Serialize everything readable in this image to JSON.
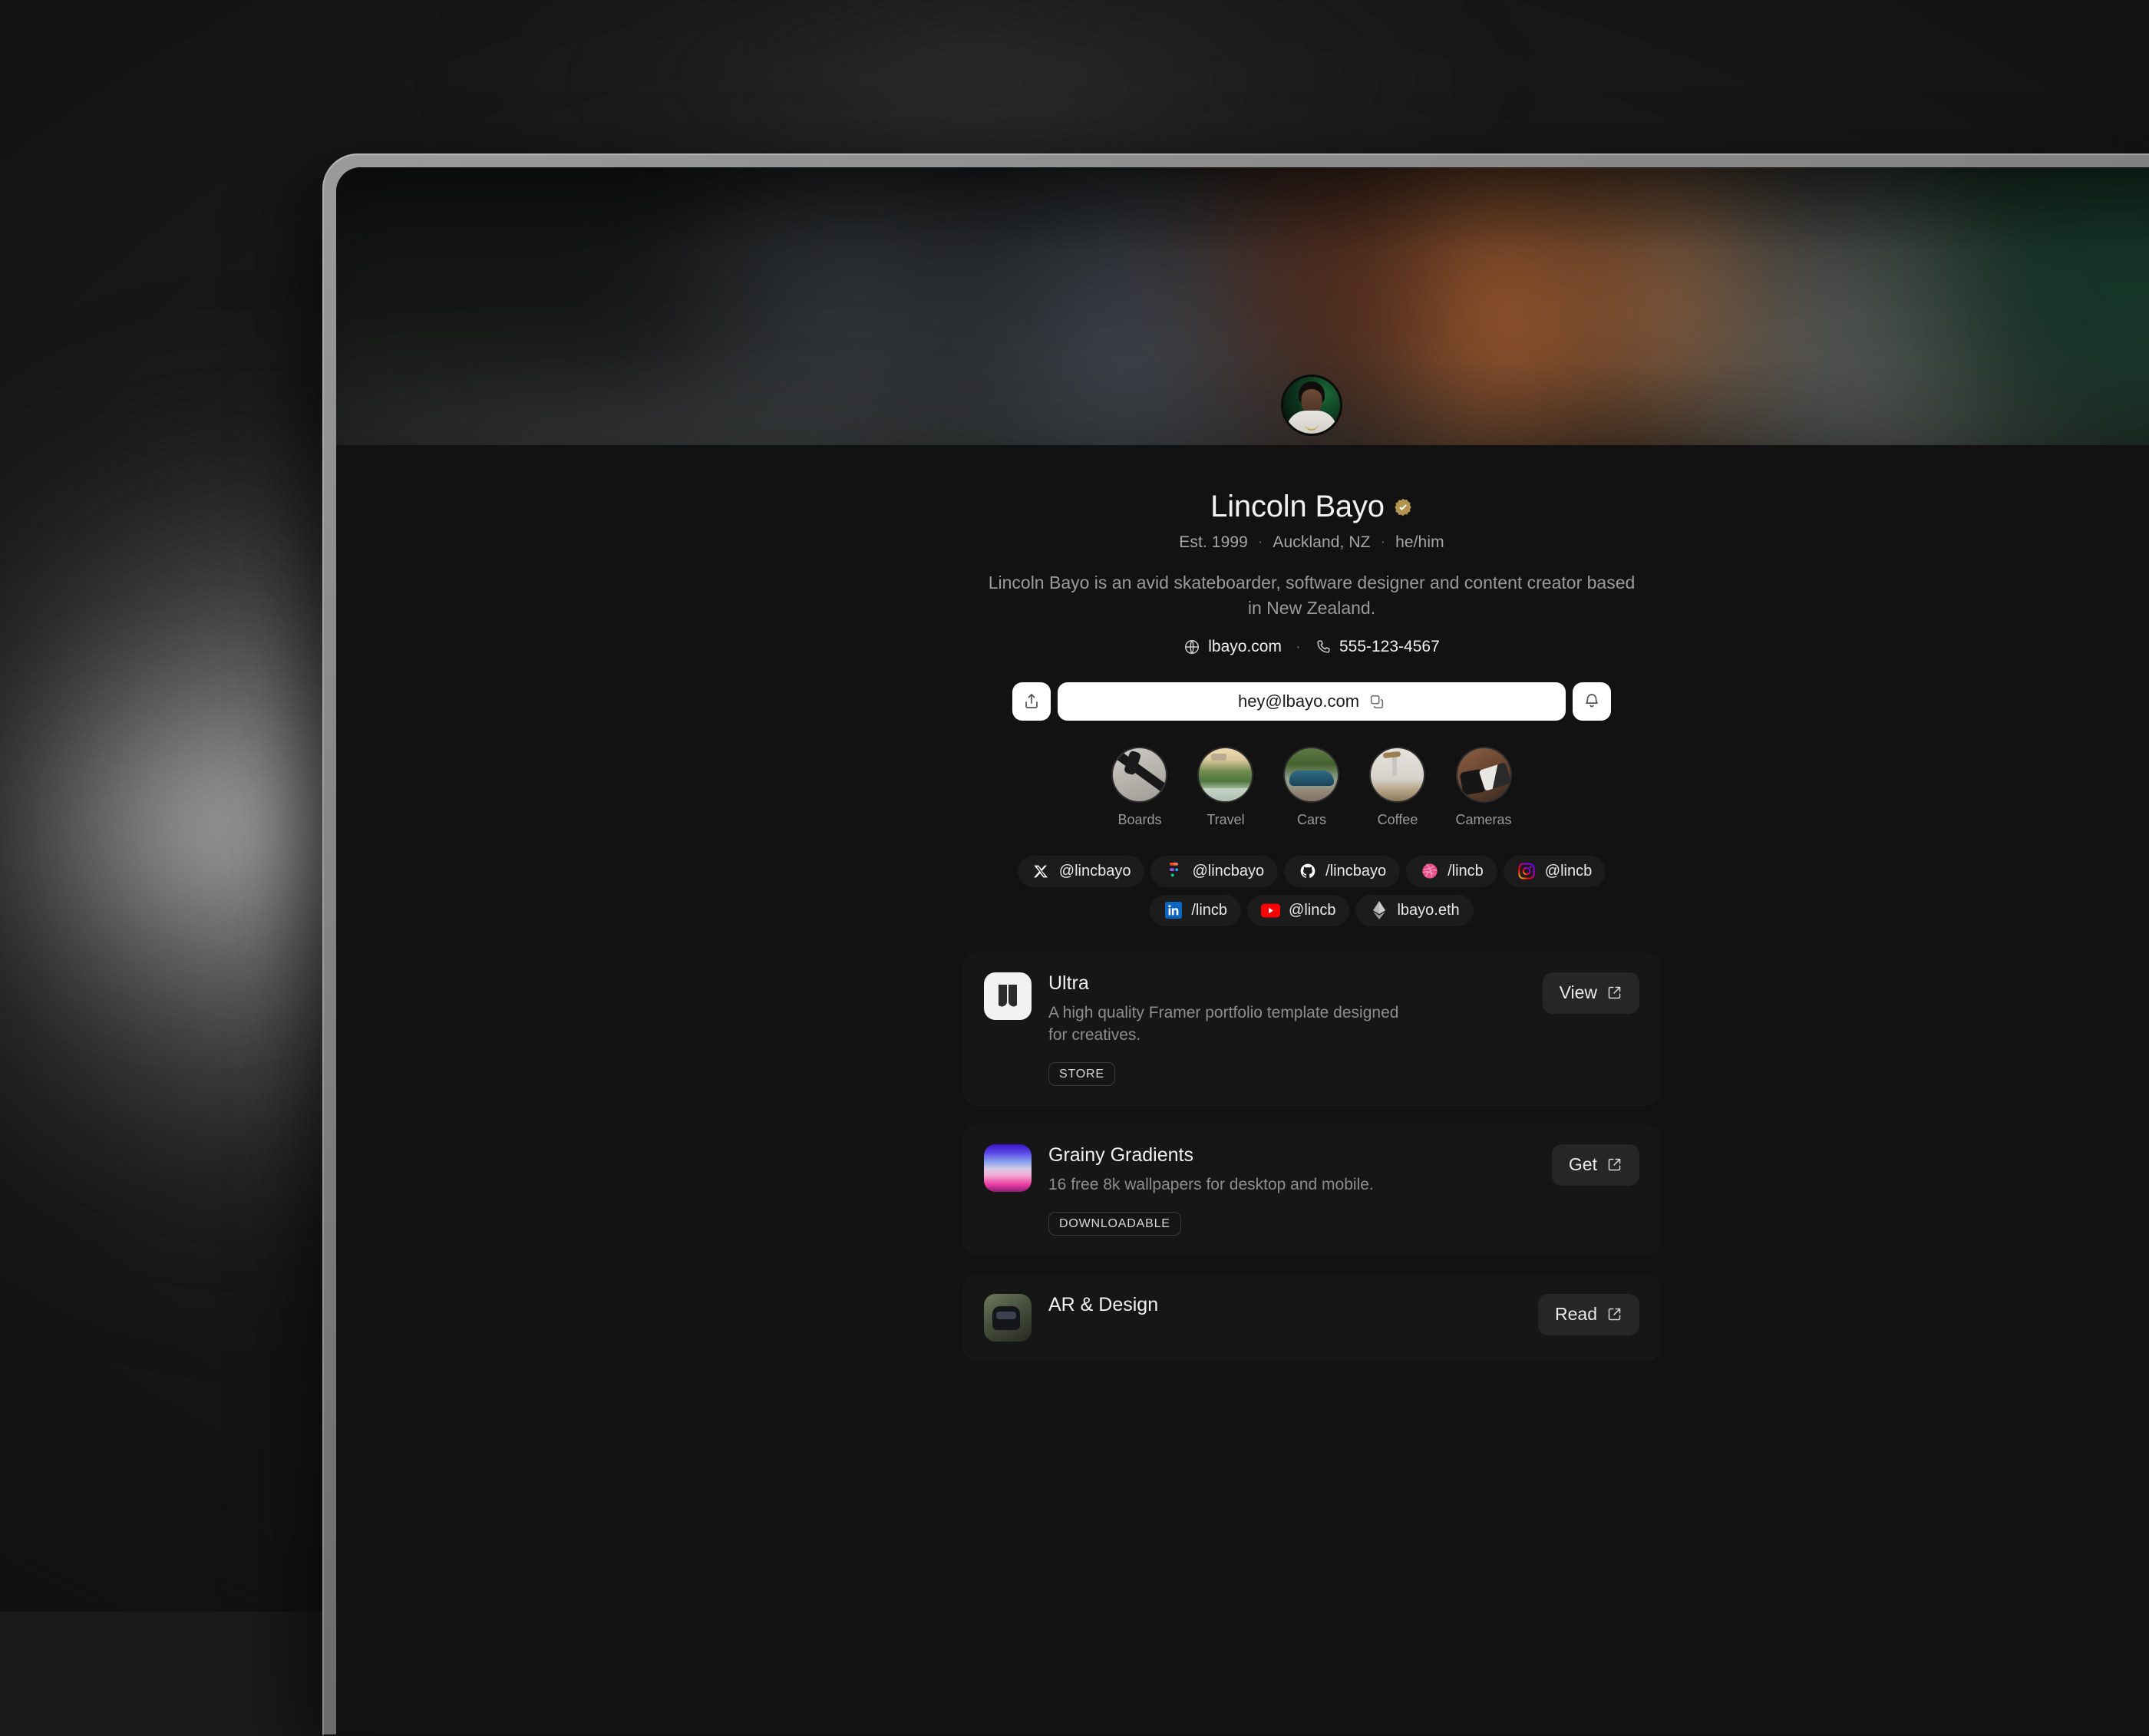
{
  "profile": {
    "name": "Lincoln Bayo",
    "verified_badge": "verified-icon",
    "meta": {
      "established": "Est. 1999",
      "location": "Auckland, NZ",
      "pronouns": "he/him",
      "separator": "·"
    },
    "bio": "Lincoln Bayo is an avid skateboarder, software designer and content creator based in New Zealand.",
    "website": "lbayo.com",
    "phone": "555-123-4567",
    "contact_separator": "·"
  },
  "actions": {
    "share_icon": "share-icon",
    "email": "hey@lbayo.com",
    "copy_icon": "copy-icon",
    "subscribe_icon": "bell-icon"
  },
  "stories": [
    {
      "label": "Boards",
      "thumb": "skateboard-photo"
    },
    {
      "label": "Travel",
      "thumb": "landscape-photo"
    },
    {
      "label": "Cars",
      "thumb": "classic-car-photo"
    },
    {
      "label": "Coffee",
      "thumb": "pourover-coffee-photo"
    },
    {
      "label": "Cameras",
      "thumb": "camera-gear-photo"
    }
  ],
  "socials": [
    {
      "icon": "x-icon",
      "handle": "@lincbayo"
    },
    {
      "icon": "figma-icon",
      "handle": "@lincbayo"
    },
    {
      "icon": "github-icon",
      "handle": "/lincbayo"
    },
    {
      "icon": "dribbble-icon",
      "handle": "/lincb"
    },
    {
      "icon": "instagram-icon",
      "handle": "@lincb"
    },
    {
      "icon": "linkedin-icon",
      "handle": "/lincb"
    },
    {
      "icon": "youtube-icon",
      "handle": "@lincb"
    },
    {
      "icon": "ethereum-icon",
      "handle": "lbayo.eth"
    }
  ],
  "cards": [
    {
      "title": "Ultra",
      "description": "A high quality Framer portfolio template designed for creatives.",
      "tag": "STORE",
      "cta": "View",
      "cta_icon": "external-link-icon",
      "thumb": "ultra-logo"
    },
    {
      "title": "Grainy Gradients",
      "description": "16 free 8k wallpapers for desktop and mobile.",
      "tag": "DOWNLOADABLE",
      "cta": "Get",
      "cta_icon": "external-link-icon",
      "thumb": "gradient-swatch"
    },
    {
      "title": "AR & Design",
      "description": "",
      "tag": "",
      "cta": "Read",
      "cta_icon": "external-link-icon",
      "thumb": "ar-headset-photo"
    }
  ],
  "colors": {
    "page_background": "#121212",
    "card_background": "#161616",
    "chip_background": "#1c1c1c",
    "cta_background": "#262626",
    "verified_gold": "#b4934f",
    "accent_white": "#ffffff",
    "text_primary": "#f0f0f0",
    "text_muted": "#8d8d8d",
    "desk_background": "#1b1b1b"
  }
}
